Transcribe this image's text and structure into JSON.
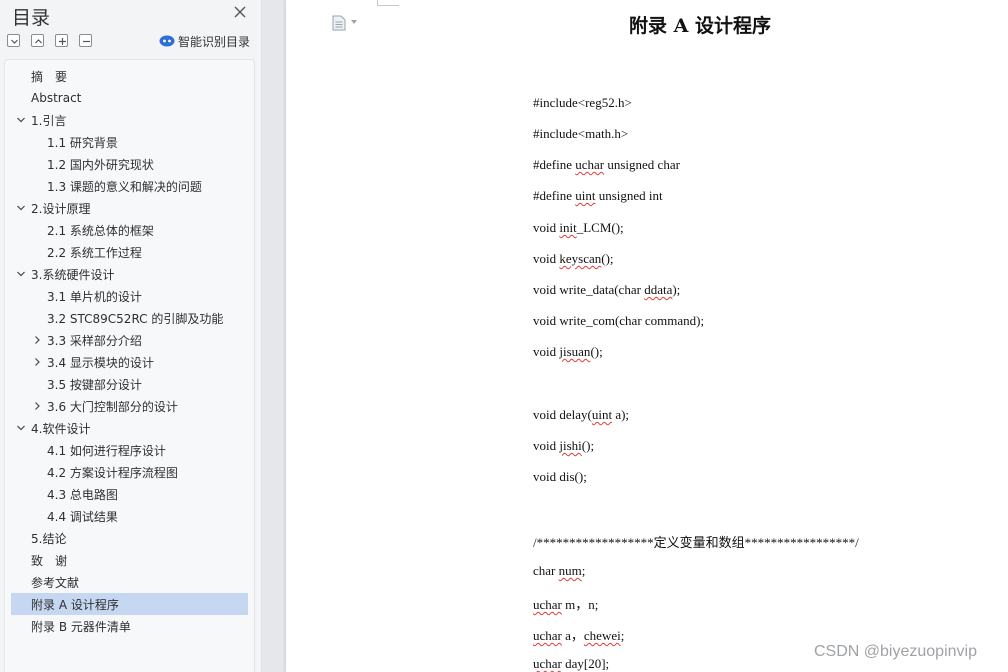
{
  "toc": {
    "title": "目录",
    "smart_label": "智能识别目录",
    "items": [
      {
        "label": "摘　要"
      },
      {
        "label": "Abstract"
      },
      {
        "label": "1.引言"
      },
      {
        "label": "1.1  研究背景"
      },
      {
        "label": "1.2  国内外研究现状"
      },
      {
        "label": "1.3  课题的意义和解决的问题"
      },
      {
        "label": "2.设计原理"
      },
      {
        "label": "2.1  系统总体的框架"
      },
      {
        "label": "2.2  系统工作过程"
      },
      {
        "label": "3.系统硬件设计"
      },
      {
        "label": "3.1  单片机的设计"
      },
      {
        "label": "3.2 STC89C52RC 的引脚及功能"
      },
      {
        "label": "3.3  采样部分介绍"
      },
      {
        "label": "3.4  显示模块的设计"
      },
      {
        "label": "3.5  按键部分设计"
      },
      {
        "label": "3.6  大门控制部分的设计"
      },
      {
        "label": "4.软件设计"
      },
      {
        "label": "4.1  如何进行程序设计"
      },
      {
        "label": "4.2  方案设计程序流程图"
      },
      {
        "label": "4.3  总电路图"
      },
      {
        "label": "4.4  调试结果"
      },
      {
        "label": "5.结论"
      },
      {
        "label": "致　谢"
      },
      {
        "label": "参考文献"
      },
      {
        "label": "附录 A 设计程序"
      },
      {
        "label": "附录 B 元器件清单"
      }
    ],
    "active_label": "附录 A 设计程序"
  },
  "document": {
    "heading": "附录 A 设计程序",
    "code": [
      [
        "#include<reg52.h>"
      ],
      [
        "#include<math.h>"
      ],
      [
        "#define ",
        "uchar",
        " unsigned char"
      ],
      [
        "#define ",
        "uint",
        " unsigned int"
      ],
      [
        "void ",
        "init",
        "_LCM();"
      ],
      [
        "void ",
        "keyscan",
        "();"
      ],
      [
        "void write_data(char ",
        "ddata",
        ");"
      ],
      [
        "void write_com(char command);"
      ],
      [
        "void ",
        "jisuan",
        "();"
      ],
      [
        "void delay(",
        "uint",
        " a);"
      ],
      [
        "void ",
        "jishi",
        "();"
      ],
      [
        "void dis();"
      ],
      [
        "/******************定义变量和数组*****************/"
      ],
      [
        "char ",
        "num",
        ";"
      ],
      [
        "",
        "uchar",
        " m，n;"
      ],
      [
        "",
        "uchar",
        " a，",
        "chewei",
        ";"
      ],
      [
        "",
        "uchar",
        " day[20];"
      ]
    ]
  },
  "watermark": "CSDN @biyezuopinvip",
  "colors": {
    "active_bg": "#c6d7f2",
    "squiggle": "#e03b3b",
    "smart_icon": "#2e6fd6"
  }
}
